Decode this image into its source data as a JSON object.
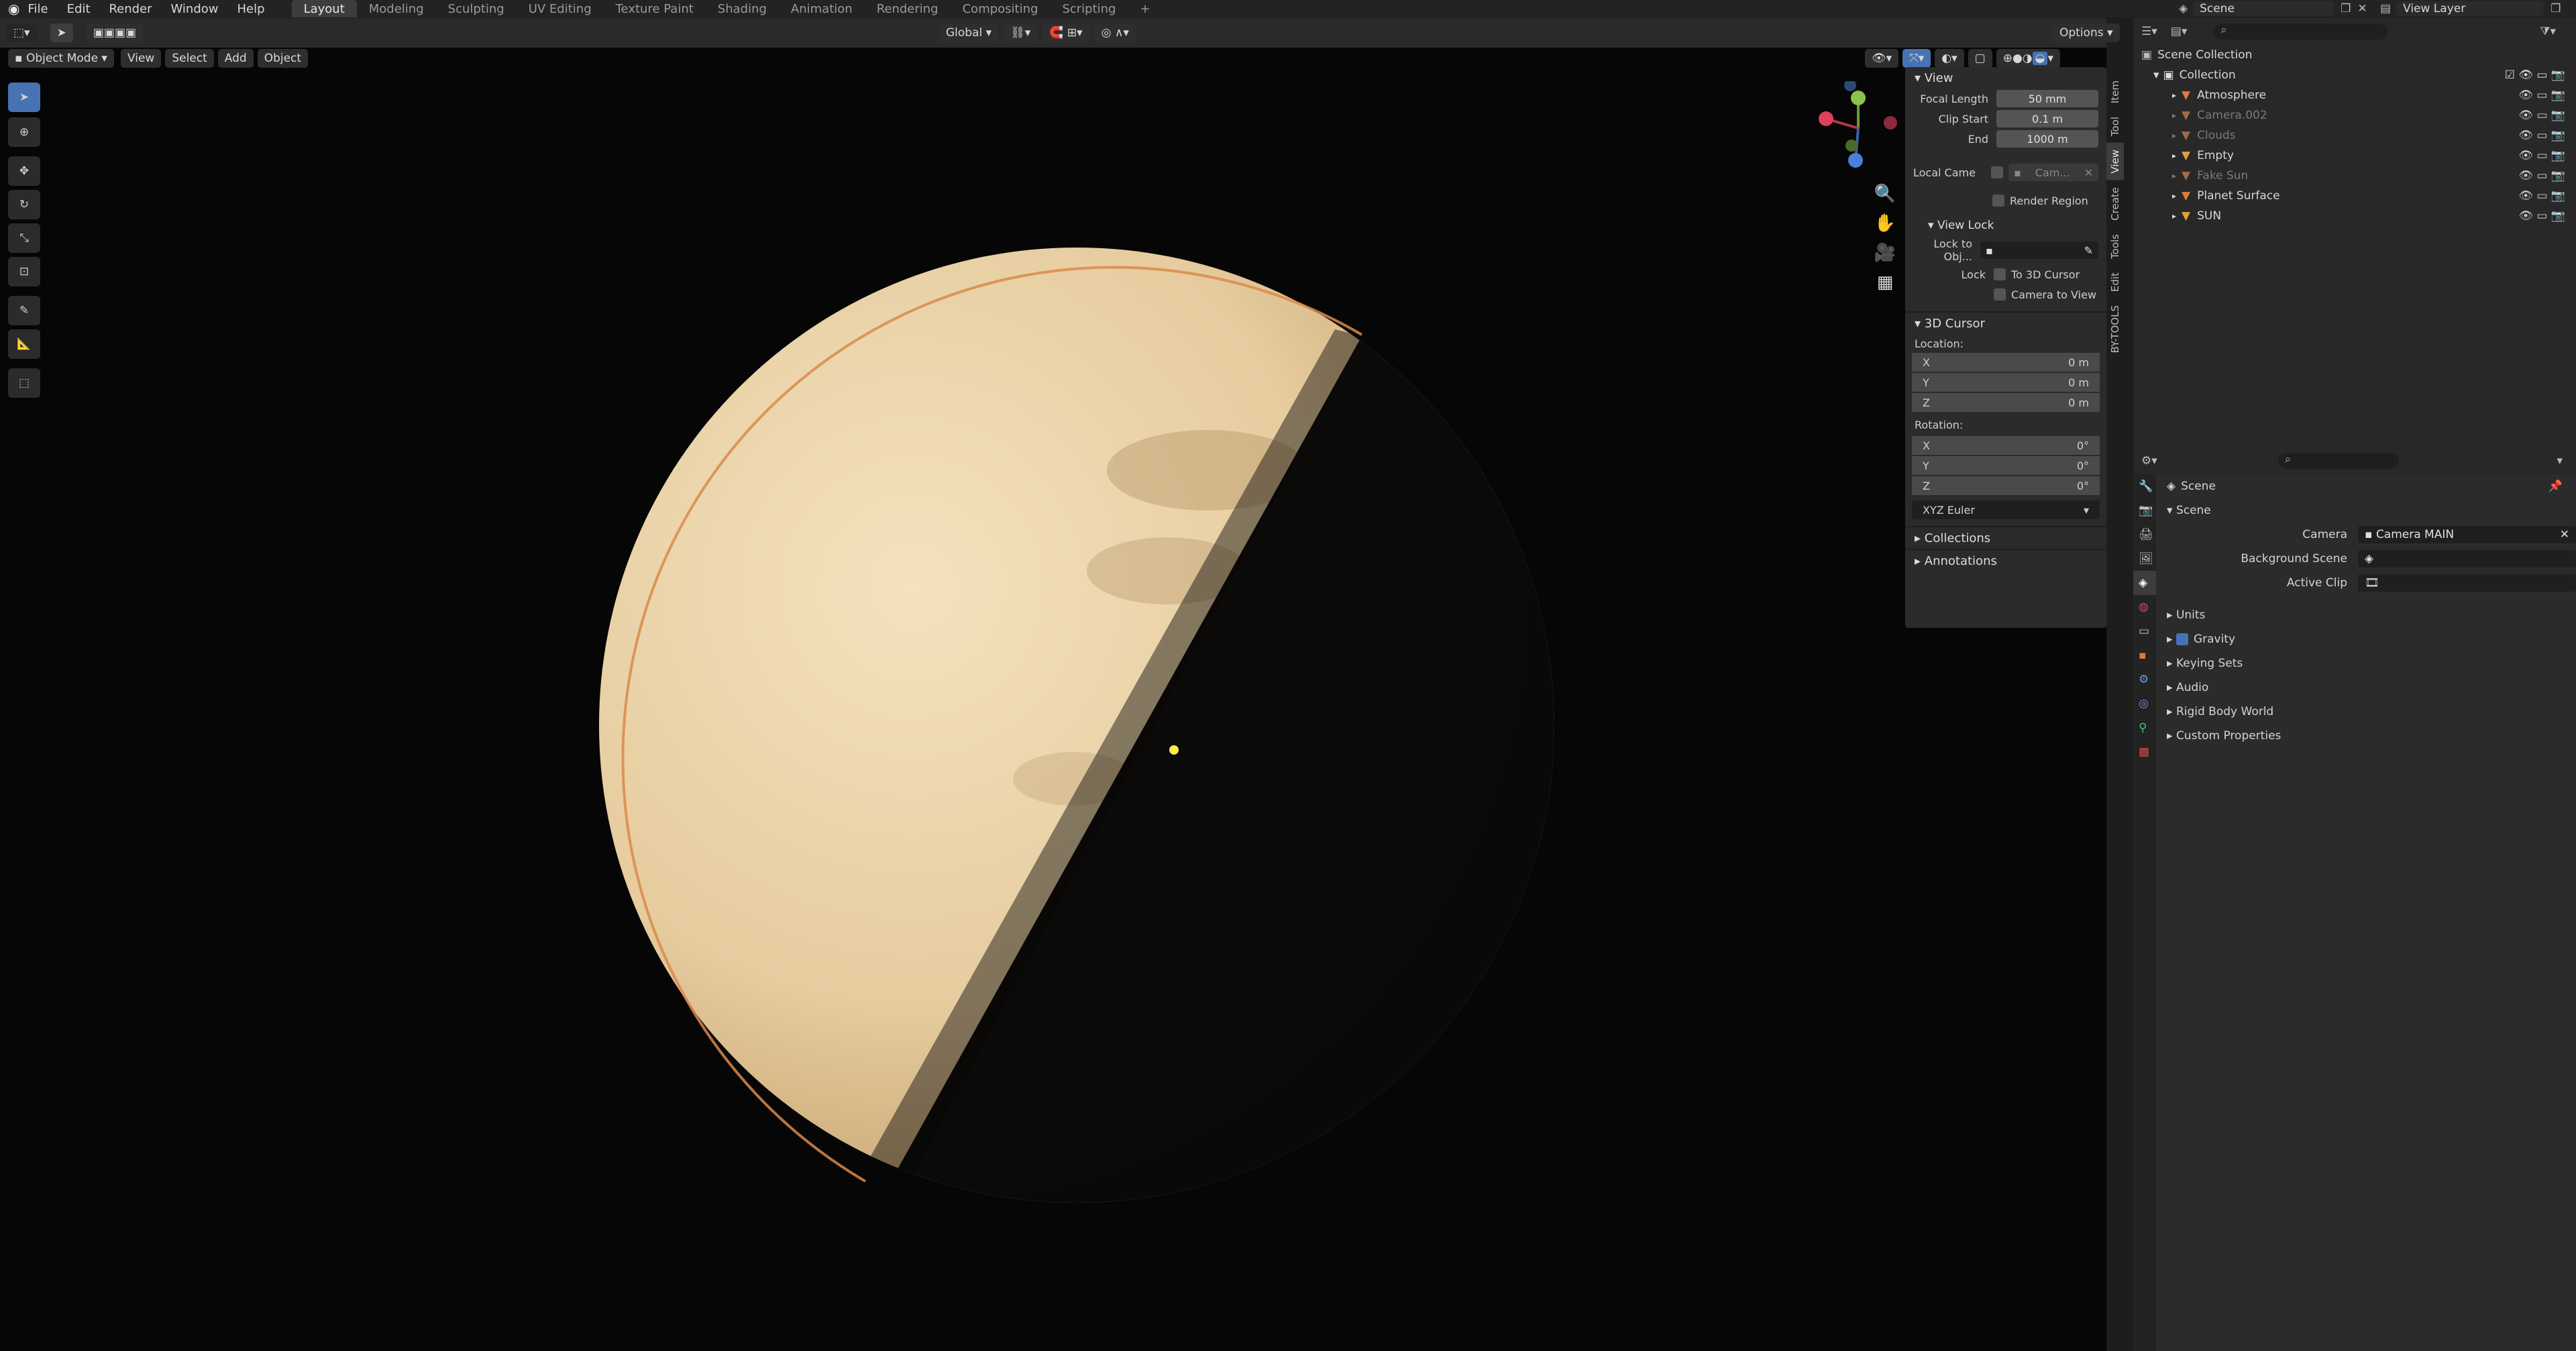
{
  "menubar": {
    "menus": [
      "File",
      "Edit",
      "Render",
      "Window",
      "Help"
    ],
    "workspaces": [
      "Layout",
      "Modeling",
      "Sculpting",
      "UV Editing",
      "Texture Paint",
      "Shading",
      "Animation",
      "Rendering",
      "Compositing",
      "Scripting",
      "+"
    ],
    "active_workspace": "Layout",
    "scene_name": "Scene",
    "view_layer_name": "View Layer"
  },
  "viewport": {
    "mode": "Object Mode",
    "menus": [
      "View",
      "Select",
      "Add",
      "Object"
    ],
    "transform_orientation": "Global",
    "options_label": "Options"
  },
  "npanel": {
    "tabs": [
      "Item",
      "Tool",
      "View",
      "Create",
      "Tools",
      "Edit",
      "BY-TOOLS"
    ],
    "active_tab": "View",
    "view": {
      "title": "View",
      "focal_length_label": "Focal Length",
      "focal_length": "50 mm",
      "clip_start_label": "Clip Start",
      "clip_start": "0.1 m",
      "clip_end_label": "End",
      "clip_end": "1000 m",
      "local_camera_label": "Local Came",
      "local_camera_value": "Cam...",
      "render_region_label": "Render Region"
    },
    "view_lock": {
      "title": "View Lock",
      "lock_to_object_label": "Lock to Obj...",
      "lock_label": "Lock",
      "to_3d_cursor_label": "To 3D Cursor",
      "camera_to_view_label": "Camera to View"
    },
    "cursor": {
      "title": "3D Cursor",
      "location_label": "Location:",
      "location": [
        {
          "axis": "X",
          "value": "0 m"
        },
        {
          "axis": "Y",
          "value": "0 m"
        },
        {
          "axis": "Z",
          "value": "0 m"
        }
      ],
      "rotation_label": "Rotation:",
      "rotation": [
        {
          "axis": "X",
          "value": "0°"
        },
        {
          "axis": "Y",
          "value": "0°"
        },
        {
          "axis": "Z",
          "value": "0°"
        }
      ],
      "rotation_mode": "XYZ Euler"
    },
    "collections_label": "Collections",
    "annotations_label": "Annotations"
  },
  "outliner": {
    "root": "Scene Collection",
    "collection": "Collection",
    "items": [
      {
        "name": "Atmosphere",
        "dim": false,
        "color": "#e07a3a"
      },
      {
        "name": "Camera.002",
        "dim": true,
        "color": "#a36a4a"
      },
      {
        "name": "Clouds",
        "dim": true,
        "color": "#a36a4a"
      },
      {
        "name": "Empty",
        "dim": false,
        "color": "#e0a23a"
      },
      {
        "name": "Fake Sun",
        "dim": true,
        "color": "#a36a4a"
      },
      {
        "name": "Planet Surface",
        "dim": false,
        "color": "#e07a3a"
      },
      {
        "name": "SUN",
        "dim": false,
        "color": "#e0a23a"
      }
    ]
  },
  "properties": {
    "breadcrumb": "Scene",
    "panel_title": "Scene",
    "camera_label": "Camera",
    "camera_value": "Camera MAIN",
    "background_scene_label": "Background Scene",
    "active_clip_label": "Active Clip",
    "sections": [
      "Units",
      "Gravity",
      "Keying Sets",
      "Audio",
      "Rigid Body World",
      "Custom Properties"
    ]
  },
  "colors": {
    "accent": "#4772b3",
    "planet_light": "#f2ddb4",
    "planet_mid": "#e3c79b",
    "planet_rim": "#d98a4a",
    "background": "#060606"
  }
}
